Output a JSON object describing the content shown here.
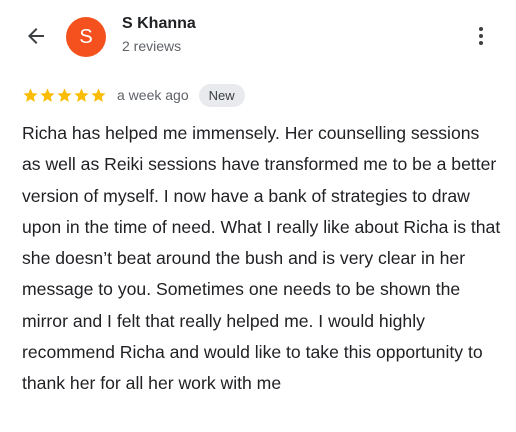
{
  "reviewer": {
    "avatar_letter": "S",
    "avatar_color": "#f4511e",
    "name": "S Khanna",
    "review_count": "2 reviews"
  },
  "header": {
    "back_icon": "arrow-back-icon",
    "menu_icon": "more-vert-icon"
  },
  "review": {
    "rating": 5,
    "rating_max": 5,
    "star_color": "#fbbc04",
    "time": "a week ago",
    "badge": "New",
    "text": "Richa has helped me immensely. Her counselling sessions as well as Reiki sessions have transformed me to be a better version of myself. I now have a bank of strategies to draw upon in the time of need. What I really like about Richa is that she doesn’t beat around the bush and is very clear in her message to you. Sometimes one needs to be shown the mirror and I felt that really helped me. I would highly recommend Richa and would like to take this opportunity to thank her for all her work with me"
  }
}
